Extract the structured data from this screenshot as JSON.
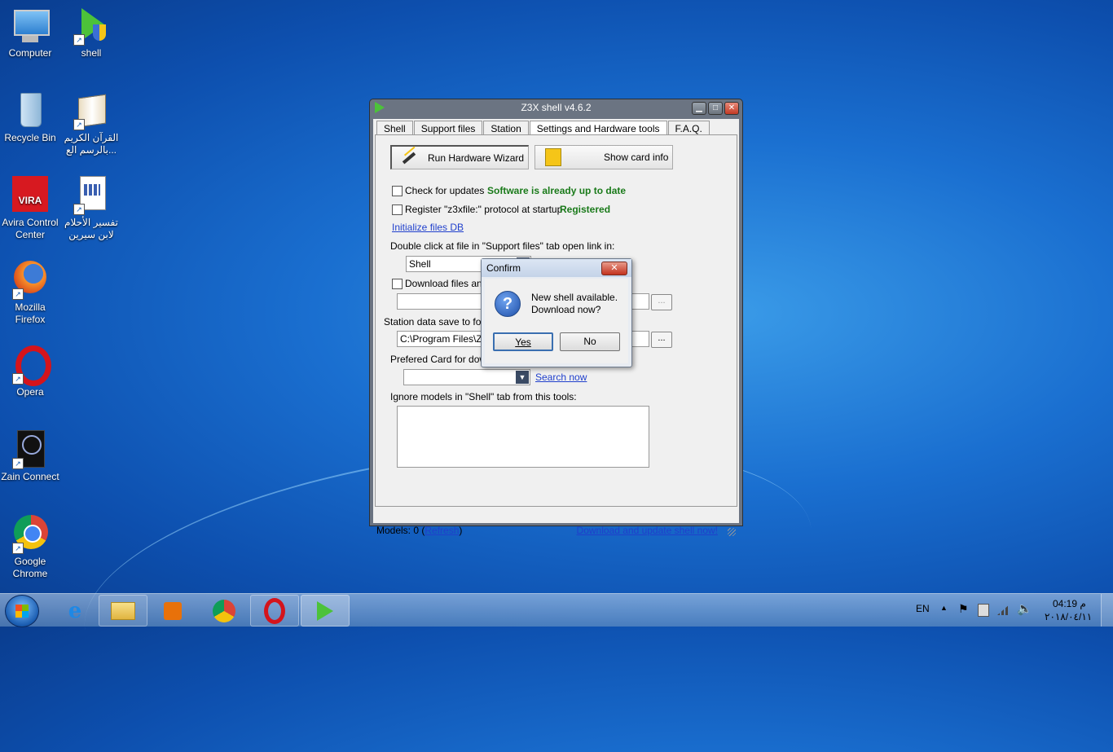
{
  "desktop": {
    "icons": [
      {
        "label": "Computer"
      },
      {
        "label": "shell"
      },
      {
        "label": "Recycle Bin"
      },
      {
        "label": "القرآن الكريم بالرسم الع..."
      },
      {
        "label": "Avira Control Center"
      },
      {
        "label": "تفسير الأحلام لابن سيرين"
      },
      {
        "label": "Mozilla Firefox"
      },
      {
        "label": "Opera"
      },
      {
        "label": "Zain Connect"
      },
      {
        "label": "Google Chrome"
      }
    ]
  },
  "window": {
    "title": "Z3X shell v4.6.2",
    "tabs": [
      "Shell",
      "Support files",
      "Station",
      "Settings and Hardware tools",
      "F.A.Q."
    ],
    "run_wizard": "Run Hardware Wizard",
    "show_card": "Show card info",
    "check_updates": "Check for updates",
    "update_status": "Software is already up to date",
    "register_protocol": "Register \"z3xfile:\" protocol at startup",
    "register_status": "Registered",
    "init_db": "Initialize files DB",
    "double_click_label": "Double click at file in \"Support files\" tab open link in:",
    "open_link_value": "Shell",
    "download_files_label": "Download files and u",
    "station_label": "Station data save to folde",
    "station_path": "C:\\Program Files\\Z3X\\",
    "prefered_card_label": "Prefered Card for down",
    "search_now": "Search now",
    "ignore_label": "Ignore models in \"Shell\" tab from this tools:",
    "browse": "...",
    "models_prefix": "Models: 0 (",
    "refresh": "Refresh",
    "models_suffix": ")",
    "download_link": "Download and update shell now!"
  },
  "dialog": {
    "title": "Confirm",
    "line1": "New shell available.",
    "line2": "Download now?",
    "yes": "Yes",
    "no": "No"
  },
  "taskbar": {
    "lang": "EN",
    "time": "04:19 م",
    "date": "٢٠١٨/٠٤/١١"
  }
}
